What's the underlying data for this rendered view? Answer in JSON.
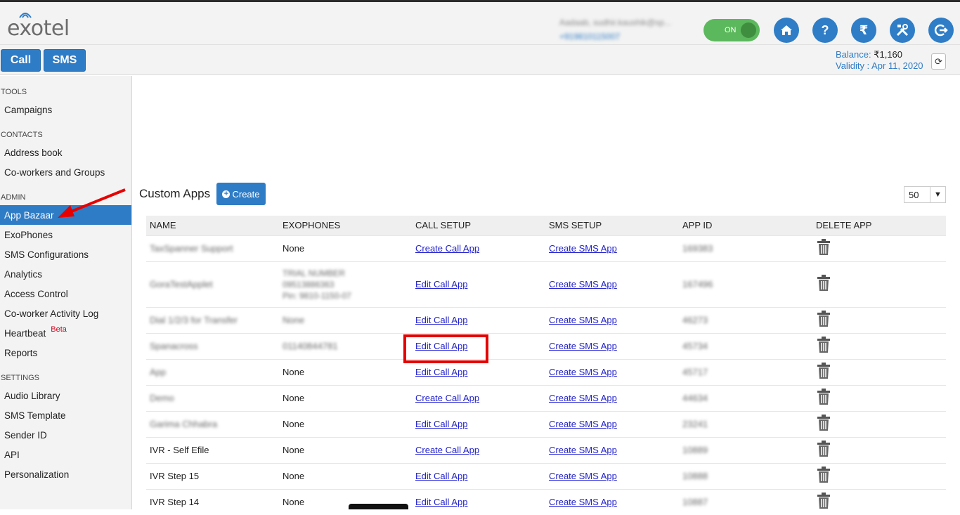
{
  "header": {
    "logo_text": "exotel",
    "user_name": "Aadaab, sudhir.kaushik@sp...",
    "user_phone": "+919810115007",
    "toggle_label": "ON",
    "call_label": "Call",
    "sms_label": "SMS",
    "balance_label": "Balance:",
    "balance_value": "₹1,160",
    "validity_label": "Validity : Apr 11, 2020",
    "icons": [
      "home-icon",
      "help-icon",
      "rupee-icon",
      "tools-icon",
      "logout-icon",
      "refresh-icon"
    ]
  },
  "sidebar": {
    "sections": [
      {
        "title": "TOOLS",
        "items": [
          "Campaigns"
        ]
      },
      {
        "title": "CONTACTS",
        "items": [
          "Address book",
          "Co-workers and Groups"
        ]
      },
      {
        "title": "ADMIN",
        "items": [
          "App Bazaar",
          "ExoPhones",
          "SMS Configurations",
          "Analytics",
          "Access Control",
          "Co-worker Activity Log",
          "Heartbeat",
          "Reports"
        ]
      },
      {
        "title": "SETTINGS",
        "items": [
          "Audio Library",
          "SMS Template",
          "Sender ID",
          "API",
          "Personalization"
        ]
      }
    ],
    "beta_label": "Beta",
    "active_item": "App Bazaar"
  },
  "main": {
    "title": "Custom Apps",
    "create_label": "Create",
    "per_page": "50",
    "columns": [
      "NAME",
      "EXOPHONES",
      "CALL SETUP",
      "SMS SETUP",
      "APP ID",
      "DELETE APP"
    ],
    "rows": [
      {
        "name": "TaxSpanner Support",
        "exophones": "None",
        "call": "Create Call App",
        "sms": "Create SMS App",
        "app_id": "169383"
      },
      {
        "name": "GoraTestApplet",
        "exophones": "TRIAL NUMBER|09513886363|Pin: 9810-1150-07",
        "call": "Edit Call App",
        "sms": "Create SMS App",
        "app_id": "167496"
      },
      {
        "name": "Dial 1/2/3 for Transfer",
        "exophones": "None",
        "call": "Edit Call App",
        "sms": "Create SMS App",
        "app_id": "46273"
      },
      {
        "name": "Spanacross",
        "exophones": "01140844781",
        "call": "Edit Call App",
        "sms": "Create SMS App",
        "app_id": "45734"
      },
      {
        "name": "App",
        "exophones": "None",
        "call": "Edit Call App",
        "sms": "Create SMS App",
        "app_id": "45717"
      },
      {
        "name": "Demo",
        "exophones": "None",
        "call": "Create Call App",
        "sms": "Create SMS App",
        "app_id": "44634"
      },
      {
        "name": "Garima Chhabra",
        "exophones": "None",
        "call": "Edit Call App",
        "sms": "Create SMS App",
        "app_id": "23241"
      },
      {
        "name": "IVR - Self Efile",
        "exophones": "None",
        "call": "Create Call App",
        "sms": "Create SMS App",
        "app_id": "10889"
      },
      {
        "name": "IVR Step 15",
        "exophones": "None",
        "call": "Edit Call App",
        "sms": "Create SMS App",
        "app_id": "10888"
      },
      {
        "name": "IVR Step 14",
        "exophones": "None",
        "call": "Edit Call App",
        "sms": "Create SMS App",
        "app_id": "10887"
      }
    ]
  },
  "colors": {
    "accent": "#2f7cc6",
    "toggle_on": "#5cb85c",
    "highlight": "#e60000",
    "beta": "#d0021b"
  }
}
